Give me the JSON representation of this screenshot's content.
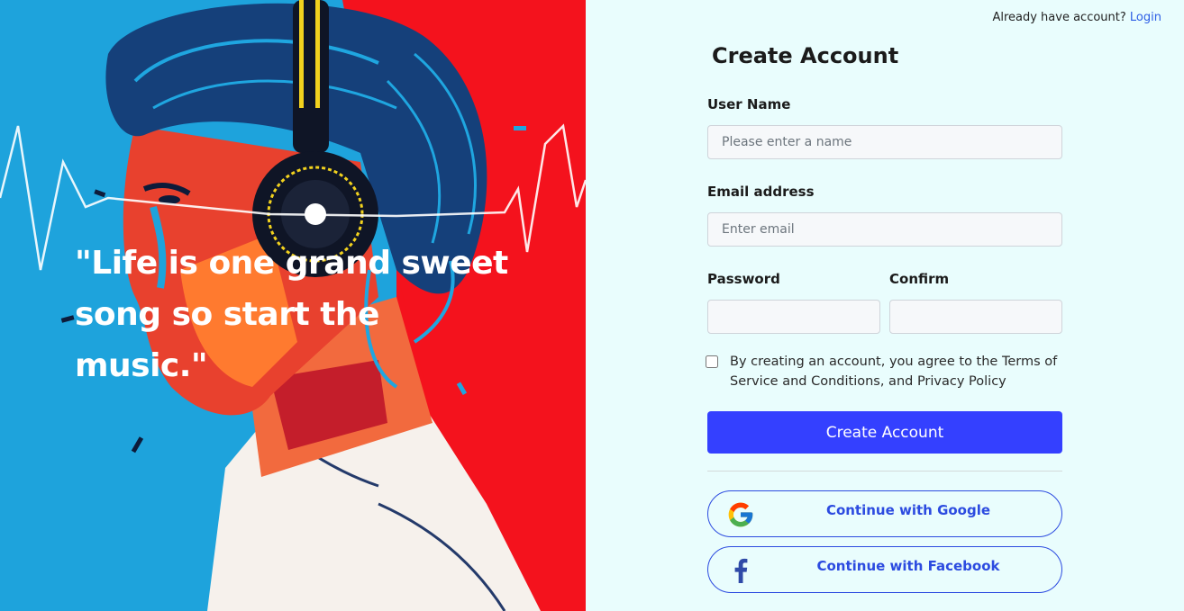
{
  "hero": {
    "quote": "\"Life is one grand sweet song so start the music.\""
  },
  "header": {
    "prompt": "Already have account?",
    "login_label": "Login"
  },
  "form": {
    "title": "Create Account",
    "username": {
      "label": "User Name",
      "placeholder": "Please enter a name"
    },
    "email": {
      "label": "Email address",
      "placeholder": "Enter email"
    },
    "password": {
      "label": "Password"
    },
    "confirm": {
      "label": "Confirm"
    },
    "terms_text": "By creating an account, you agree to the Terms of Service and Conditions, and Privacy Policy",
    "submit_label": "Create Account",
    "google_label": "Continue with Google",
    "facebook_label": "Continue with Facebook"
  },
  "colors": {
    "background": "#e9fdfd",
    "primary": "#3440ff",
    "social_accent": "#2c4be0",
    "link": "#2c5de5"
  },
  "icons": {
    "google": "google-icon",
    "facebook": "facebook-icon"
  }
}
